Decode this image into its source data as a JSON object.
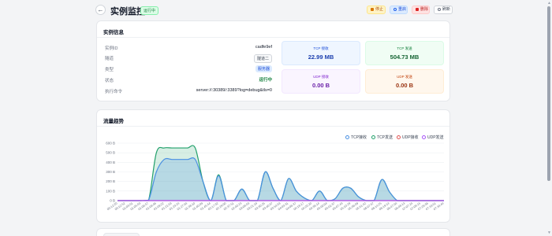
{
  "header": {
    "back_icon": "arrow-left-icon",
    "title": "实例监控",
    "status_badge": "运行中",
    "buttons": {
      "stop": "停止",
      "restart": "重启",
      "delete": "删除",
      "refresh": "刷新"
    }
  },
  "info": {
    "title": "实例信息",
    "rows": [
      {
        "label": "实例ID",
        "value": "cadfe9ef"
      },
      {
        "label": "隧道",
        "value": "隧道二"
      },
      {
        "label": "类型",
        "value": "服务器"
      },
      {
        "label": "状态",
        "value": "运行中"
      },
      {
        "label": "执行命令",
        "value": "server://:30389/:3389?log=debug&tls=0"
      }
    ],
    "stats": {
      "tcp_in": {
        "label": "TCP 接收",
        "value": "22.99 MB"
      },
      "tcp_out": {
        "label": "TCP 发送",
        "value": "504.73 MB"
      },
      "udp_in": {
        "label": "UDP 接收",
        "value": "0.00 B"
      },
      "udp_out": {
        "label": "UDP 发送",
        "value": "0.00 B"
      }
    }
  },
  "chart": {
    "title": "流量趋势"
  },
  "colors": {
    "tcp_in": "#4a90e2",
    "tcp_out": "#22a06b",
    "udp_in": "#e05252",
    "udp_out": "#a855f7"
  },
  "chart_data": {
    "type": "area",
    "title": "",
    "xlabel": "",
    "ylabel": "",
    "ylim": [
      0,
      600
    ],
    "y_ticks": [
      "0 B",
      "100 B",
      "200 B",
      "300 B",
      "400 B",
      "500 B",
      "600 B"
    ],
    "grid": true,
    "legend_position": "top-right",
    "x": [
      "00:12:20",
      "00:12:52",
      "01:03:01",
      "01:05:03",
      "01:06:57",
      "01:08:46",
      "01:09:22",
      "01:21:03",
      "01:23:24",
      "01:27:04",
      "01:38:10",
      "01:40:09",
      "01:45:54",
      "02:17:32",
      "02:28:00",
      "02:37:51",
      "02:40:23",
      "03:08:03",
      "03:21:18",
      "03:30:25",
      "03:40:37",
      "03:54:03",
      "04:03:31",
      "04:06:37",
      "04:18:17",
      "04:20:20",
      "04:36:14",
      "05:00:04",
      "05:01:37",
      "05:07:43",
      "05:10:29",
      "05:36:09",
      "05:51:42",
      "06:07:57",
      "06:14:25",
      "06:19:14",
      "06:47:04",
      "06:48:13",
      "07:07:24",
      "07:09:15",
      "07:26:56",
      "07:33:51",
      "07:34:44"
    ],
    "series": [
      {
        "name": "TCP接收",
        "values": [
          0,
          0,
          0,
          0,
          5,
          300,
          430,
          430,
          430,
          430,
          430,
          200,
          0,
          260,
          0,
          0,
          120,
          0,
          0,
          300,
          130,
          0,
          230,
          100,
          30,
          0,
          100,
          0,
          20,
          130,
          130,
          40,
          0,
          0,
          220,
          90,
          0,
          0,
          0,
          0,
          0,
          0,
          0
        ]
      },
      {
        "name": "TCP发送",
        "values": [
          0,
          0,
          0,
          0,
          5,
          500,
          550,
          550,
          550,
          550,
          550,
          200,
          0,
          270,
          0,
          0,
          120,
          0,
          0,
          300,
          130,
          0,
          230,
          100,
          30,
          0,
          100,
          0,
          20,
          130,
          130,
          40,
          0,
          0,
          220,
          90,
          0,
          0,
          0,
          0,
          0,
          0,
          0
        ]
      },
      {
        "name": "UDP接收",
        "values": [
          0,
          0,
          0,
          0,
          0,
          0,
          0,
          0,
          0,
          0,
          0,
          0,
          0,
          0,
          0,
          0,
          0,
          0,
          0,
          0,
          0,
          0,
          0,
          0,
          0,
          0,
          0,
          0,
          0,
          0,
          0,
          0,
          0,
          0,
          0,
          0,
          0,
          0,
          0,
          0,
          0,
          0,
          0
        ]
      },
      {
        "name": "UDP发送",
        "values": [
          0,
          0,
          0,
          0,
          0,
          0,
          0,
          0,
          0,
          0,
          0,
          0,
          0,
          0,
          0,
          0,
          0,
          0,
          0,
          0,
          0,
          0,
          0,
          0,
          0,
          0,
          0,
          0,
          0,
          0,
          0,
          0,
          0,
          0,
          0,
          0,
          0,
          0,
          0,
          0,
          0,
          0,
          0
        ]
      }
    ]
  }
}
